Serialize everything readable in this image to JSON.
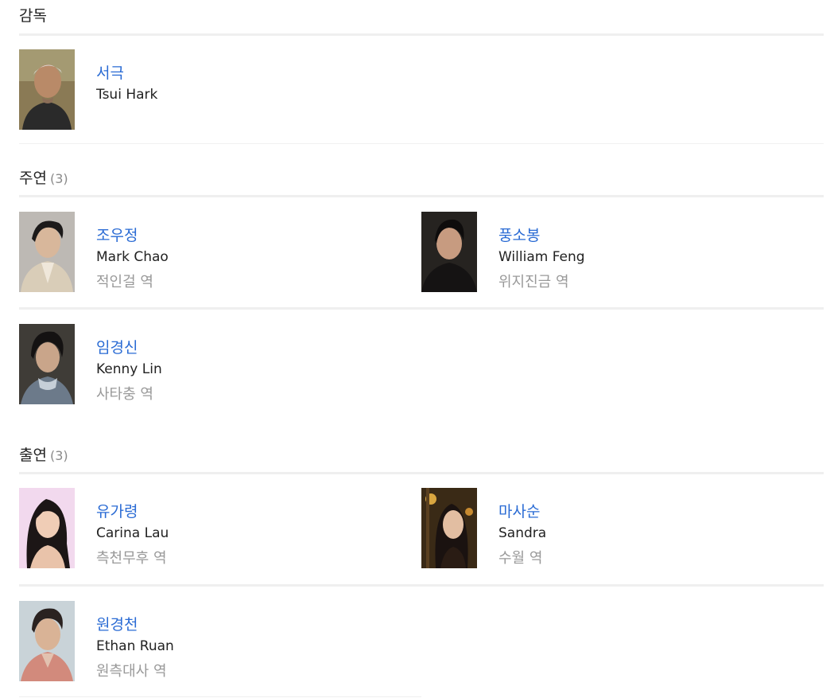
{
  "sections": {
    "director": {
      "title": "감독",
      "people": [
        {
          "name_ko": "서극",
          "name_en": "Tsui Hark"
        }
      ]
    },
    "lead": {
      "title": "주연",
      "count": "(3)",
      "people": [
        {
          "name_ko": "조우정",
          "name_en": "Mark Chao",
          "role": "적인걸 역"
        },
        {
          "name_ko": "풍소봉",
          "name_en": "William Feng",
          "role": "위지진금 역"
        },
        {
          "name_ko": "임경신",
          "name_en": "Kenny Lin",
          "role": "사타충 역"
        }
      ]
    },
    "supporting": {
      "title": "출연",
      "count": "(3)",
      "people": [
        {
          "name_ko": "유가령",
          "name_en": "Carina Lau",
          "role": "측천무후 역"
        },
        {
          "name_ko": "마사순",
          "name_en": "Sandra",
          "role": "수월 역"
        },
        {
          "name_ko": "원경천",
          "name_en": "Ethan Ruan",
          "role": "원측대사 역"
        }
      ]
    }
  },
  "colors": {
    "link": "#2a6bd4",
    "role_text": "#999999",
    "count_text": "#8a8a8a",
    "divider": "#efefef"
  }
}
